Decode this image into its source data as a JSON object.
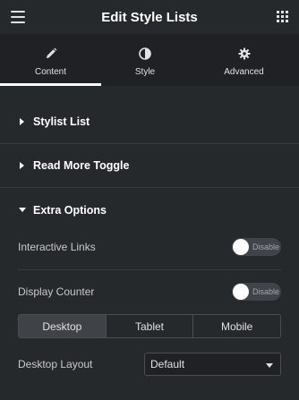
{
  "header": {
    "title": "Edit Style Lists",
    "menu_icon": "hamburger-icon",
    "apps_icon": "grid-icon"
  },
  "tabs": [
    {
      "label": "Content",
      "icon": "pencil-icon",
      "active": true
    },
    {
      "label": "Style",
      "icon": "contrast-icon",
      "active": false
    },
    {
      "label": "Advanced",
      "icon": "gear-icon",
      "active": false
    }
  ],
  "sections": [
    {
      "title": "Stylist List",
      "expanded": false
    },
    {
      "title": "Read More Toggle",
      "expanded": false
    },
    {
      "title": "Extra Options",
      "expanded": true
    }
  ],
  "extra_options": {
    "interactive_links": {
      "label": "Interactive Links",
      "toggle_text": "Disable",
      "enabled": false
    },
    "display_counter": {
      "label": "Display Counter",
      "toggle_text": "Disable",
      "enabled": false
    },
    "devices": [
      {
        "label": "Desktop",
        "active": true
      },
      {
        "label": "Tablet",
        "active": false
      },
      {
        "label": "Mobile",
        "active": false
      }
    ],
    "layout": {
      "label": "Desktop Layout",
      "value": "Default"
    }
  },
  "colors": {
    "background": "#26292c",
    "tab_bar": "#1f2124",
    "accent": "#ffffff"
  }
}
